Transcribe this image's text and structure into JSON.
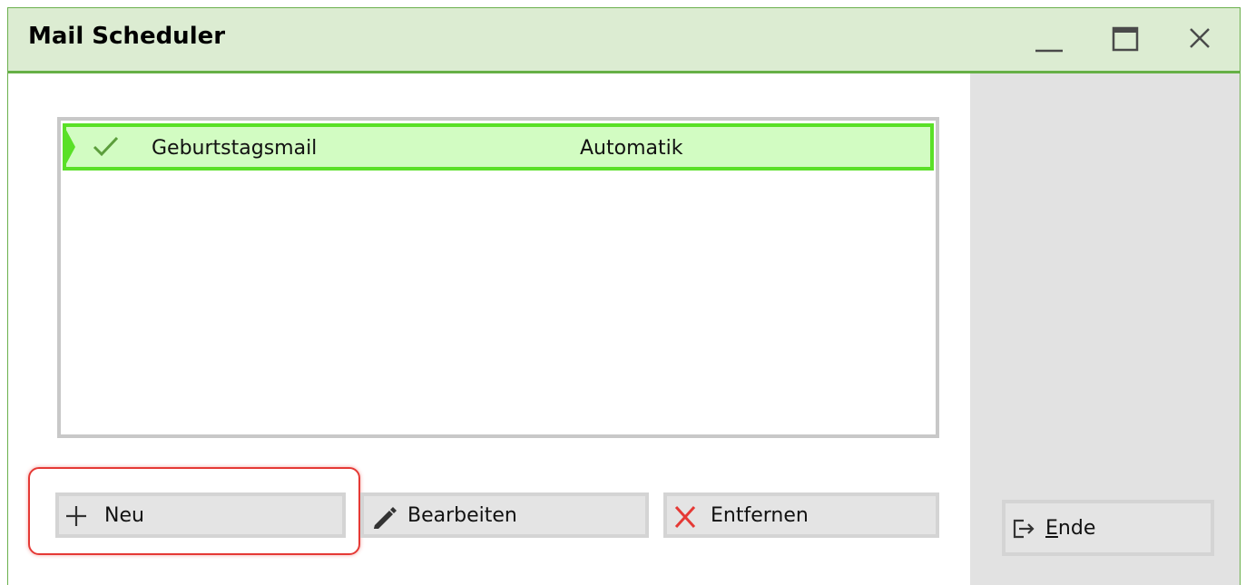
{
  "window": {
    "title": "Mail Scheduler",
    "controls": {
      "minimize_icon": "minimize-icon",
      "maximize_icon": "maximize-icon",
      "close_icon": "close-icon"
    }
  },
  "list": {
    "rows": [
      {
        "status_icon": "checkmark-icon",
        "name": "Geburtstagsmail",
        "type": "Automatik",
        "selected": true
      }
    ]
  },
  "buttons": {
    "new": {
      "label": "Neu",
      "icon": "plus-icon"
    },
    "edit": {
      "label": "Bearbeiten",
      "icon": "pencil-icon"
    },
    "remove": {
      "label": "Entfernen",
      "icon": "x-icon"
    },
    "exit": {
      "accel": "E",
      "label_rest": "nde",
      "icon": "exit-icon"
    }
  },
  "colors": {
    "titlebar_bg": "#dcecd2",
    "accent_green": "#66b046",
    "selection_bg": "#d2fcc2",
    "selection_border": "#5ae027",
    "highlight_red": "#e53935",
    "remove_red": "#e53935"
  }
}
